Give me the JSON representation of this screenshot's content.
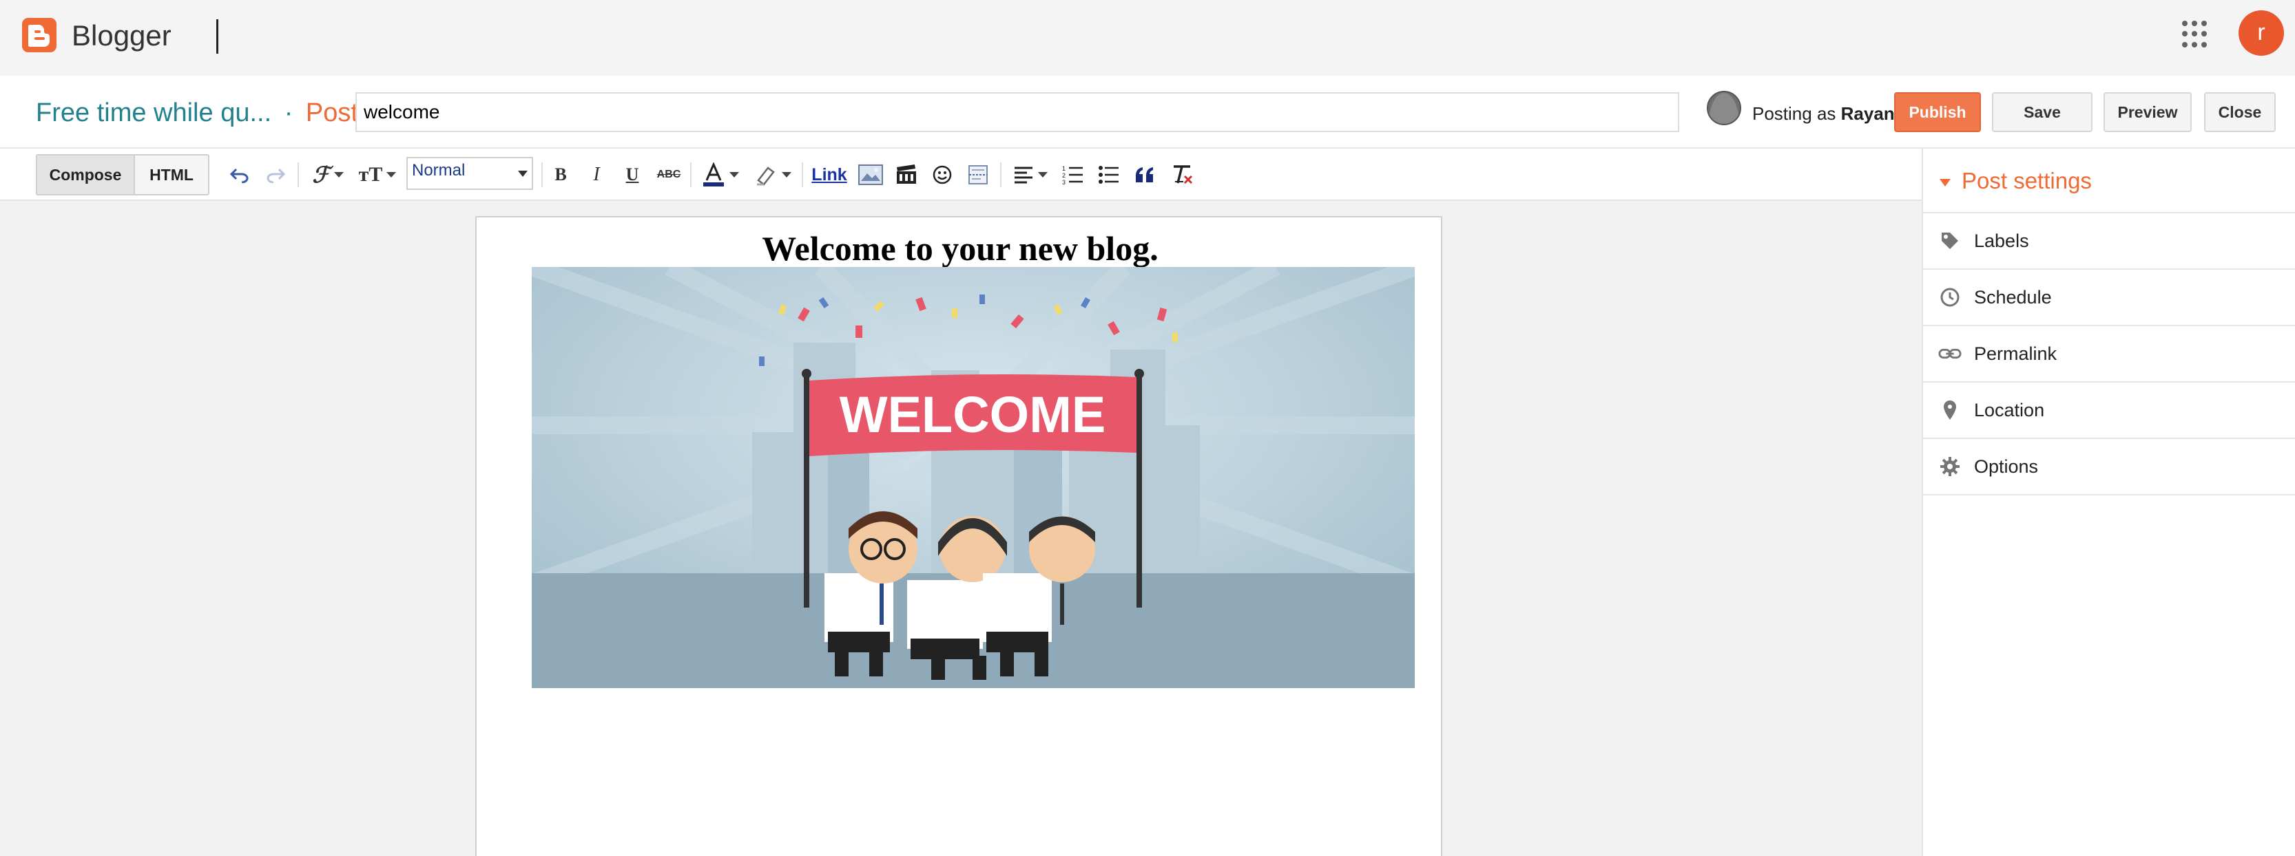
{
  "app": {
    "brand": "Blogger",
    "user_initial": "r",
    "colors": {
      "accent": "#f06a35",
      "title_teal": "#21828e",
      "publish": "#f0784b"
    }
  },
  "header": {
    "blog_title": "Free time while qu...",
    "separator": "·",
    "section": "Post",
    "post_title_value": "welcome",
    "posting_as_prefix": "Posting as",
    "posting_as_user": "Rayan",
    "buttons": {
      "publish": "Publish",
      "save": "Save",
      "preview": "Preview",
      "close": "Close"
    }
  },
  "toolbar": {
    "modes": {
      "compose": "Compose",
      "html": "HTML"
    },
    "active_mode": "Compose",
    "format_select": "Normal",
    "link_label": "Link",
    "icons": [
      "undo-icon",
      "redo-icon",
      "font-family-icon",
      "font-size-icon",
      "bold-icon",
      "italic-icon",
      "underline-icon",
      "strikethrough-icon",
      "text-color-icon",
      "highlight-icon",
      "insert-image-icon",
      "insert-video-icon",
      "emoji-icon",
      "jump-break-icon",
      "align-icon",
      "numbered-list-icon",
      "bulleted-list-icon",
      "quote-icon",
      "clear-formatting-icon"
    ]
  },
  "editor": {
    "heading": "Welcome to your new blog.",
    "image_banner_text": "WELCOME"
  },
  "sidebar": {
    "title": "Post settings",
    "items": [
      {
        "label": "Labels",
        "icon": "tag-icon"
      },
      {
        "label": "Schedule",
        "icon": "clock-icon"
      },
      {
        "label": "Permalink",
        "icon": "link-icon"
      },
      {
        "label": "Location",
        "icon": "pin-icon"
      },
      {
        "label": "Options",
        "icon": "gear-icon"
      }
    ]
  }
}
